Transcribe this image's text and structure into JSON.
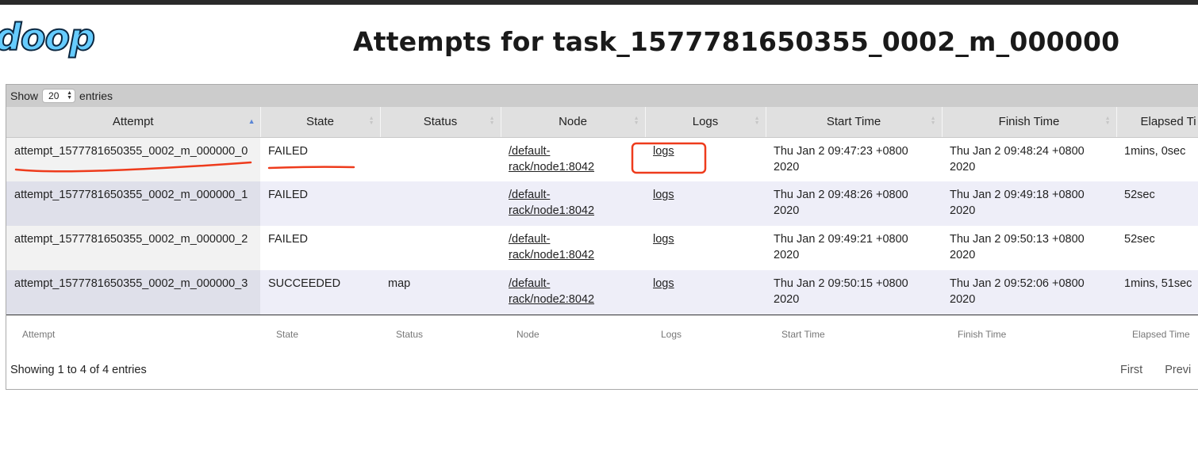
{
  "header": {
    "logo_text": "doop",
    "title": "Attempts for task_1577781650355_0002_m_000000"
  },
  "table_controls": {
    "show_label": "Show",
    "page_size": "20",
    "entries_label": "entries"
  },
  "columns": [
    "Attempt",
    "State",
    "Status",
    "Node",
    "Logs",
    "Start Time",
    "Finish Time",
    "Elapsed Ti"
  ],
  "footer_columns": [
    "Attempt",
    "State",
    "Status",
    "Node",
    "Logs",
    "Start Time",
    "Finish Time",
    "Elapsed Time"
  ],
  "rows": [
    {
      "attempt": "attempt_1577781650355_0002_m_000000_0",
      "state": "FAILED",
      "status": "",
      "node_line1": "/default-",
      "node_line2": "rack/node1:8042",
      "logs": "logs",
      "start_line1": "Thu Jan 2 09:47:23 +0800",
      "start_line2": "2020",
      "finish_line1": "Thu Jan 2 09:48:24 +0800",
      "finish_line2": "2020",
      "elapsed": "1mins, 0sec"
    },
    {
      "attempt": "attempt_1577781650355_0002_m_000000_1",
      "state": "FAILED",
      "status": "",
      "node_line1": "/default-",
      "node_line2": "rack/node1:8042",
      "logs": "logs",
      "start_line1": "Thu Jan 2 09:48:26 +0800",
      "start_line2": "2020",
      "finish_line1": "Thu Jan 2 09:49:18 +0800",
      "finish_line2": "2020",
      "elapsed": "52sec"
    },
    {
      "attempt": "attempt_1577781650355_0002_m_000000_2",
      "state": "FAILED",
      "status": "",
      "node_line1": "/default-",
      "node_line2": "rack/node1:8042",
      "logs": "logs",
      "start_line1": "Thu Jan 2 09:49:21 +0800",
      "start_line2": "2020",
      "finish_line1": "Thu Jan 2 09:50:13 +0800",
      "finish_line2": "2020",
      "elapsed": "52sec"
    },
    {
      "attempt": "attempt_1577781650355_0002_m_000000_3",
      "state": "SUCCEEDED",
      "status": "map",
      "node_line1": "/default-",
      "node_line2": "rack/node2:8042",
      "logs": "logs",
      "start_line1": "Thu Jan 2 09:50:15 +0800",
      "start_line2": "2020",
      "finish_line1": "Thu Jan 2 09:52:06 +0800",
      "finish_line2": "2020",
      "elapsed": "1mins, 51sec"
    }
  ],
  "info_text": "Showing 1 to 4 of 4 entries",
  "pagination": {
    "first": "First",
    "previous": "Previ"
  },
  "colors": {
    "annotation": "#ee3b1c",
    "header_bar": "#cccccc",
    "sort_active": "#5a86d6"
  }
}
